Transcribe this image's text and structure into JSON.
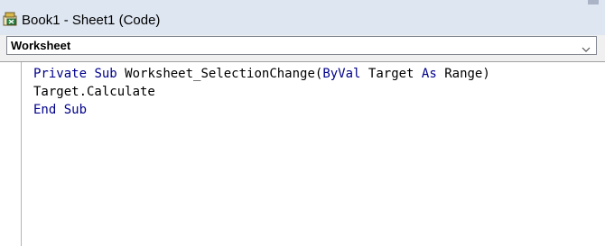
{
  "window": {
    "title": "Book1 - Sheet1 (Code)",
    "icon": "excel-module-icon"
  },
  "object_dropdown": {
    "selected": "Worksheet"
  },
  "code": {
    "lines": [
      [
        {
          "text": "Private",
          "kind": "keyword"
        },
        {
          "text": " ",
          "kind": "text"
        },
        {
          "text": "Sub",
          "kind": "keyword"
        },
        {
          "text": " Worksheet_SelectionChange(",
          "kind": "text"
        },
        {
          "text": "ByVal",
          "kind": "keyword"
        },
        {
          "text": " Target ",
          "kind": "text"
        },
        {
          "text": "As",
          "kind": "keyword"
        },
        {
          "text": " Range)",
          "kind": "text"
        }
      ],
      [
        {
          "text": "Target.Calculate",
          "kind": "text"
        }
      ],
      [
        {
          "text": "End",
          "kind": "keyword"
        },
        {
          "text": " ",
          "kind": "text"
        },
        {
          "text": "Sub",
          "kind": "keyword"
        }
      ]
    ]
  },
  "colors": {
    "keyword": "#00008b",
    "text": "#000000",
    "titlebar": "#dee6f1"
  }
}
